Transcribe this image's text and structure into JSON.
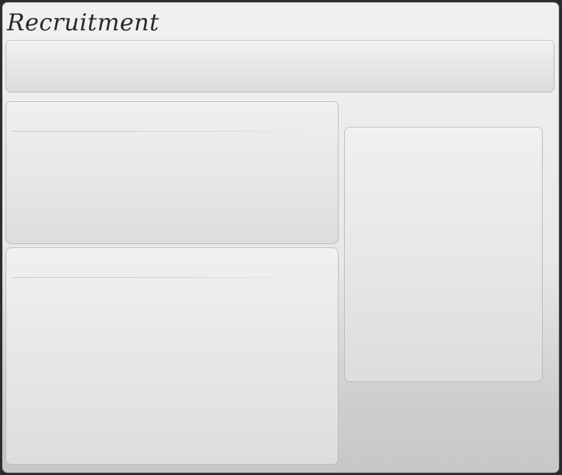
{
  "window": {
    "title": "Recruitment"
  },
  "colors": {
    "window_bg_top": "#f0f0f0",
    "window_bg_bottom": "#c8c6c8",
    "panel_border": "#b9b7b9",
    "title_text": "#2a2a2a",
    "outer_frame": "#2b2b2e"
  }
}
